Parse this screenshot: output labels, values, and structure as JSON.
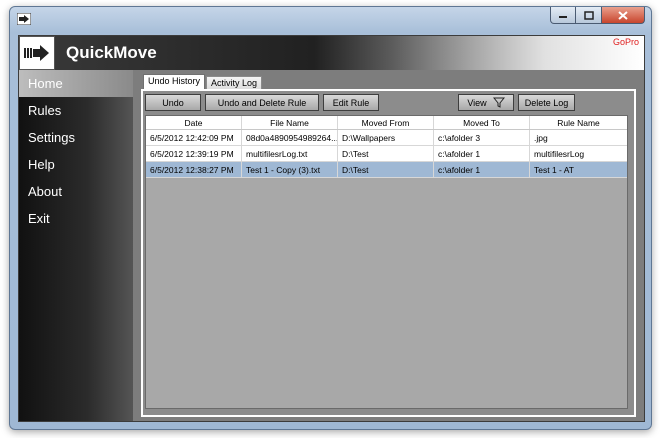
{
  "app": {
    "title": "QuickMove",
    "gopro_label": "GoPro"
  },
  "sidebar": {
    "items": [
      {
        "label": "Home",
        "active": true
      },
      {
        "label": "Rules"
      },
      {
        "label": "Settings"
      },
      {
        "label": "Help"
      },
      {
        "label": "About"
      },
      {
        "label": "Exit"
      }
    ]
  },
  "tabs": [
    {
      "label": "Undo History",
      "active": true
    },
    {
      "label": "Activity Log"
    }
  ],
  "toolbar": {
    "undo": "Undo",
    "undo_delete": "Undo and Delete Rule",
    "edit_rule": "Edit Rule",
    "view": "View",
    "delete_log": "Delete Log"
  },
  "table": {
    "headers": [
      "Date",
      "File Name",
      "Moved From",
      "Moved To",
      "Rule Name"
    ],
    "rows": [
      [
        "6/5/2012 12:42:09 PM",
        "08d0a4890954989264...",
        "D:\\Wallpapers",
        "c:\\afolder 3",
        ".jpg"
      ],
      [
        "6/5/2012 12:39:19 PM",
        "multifilesrLog.txt",
        "D:\\Test",
        "c:\\afolder 1",
        "multifilesrLog"
      ],
      [
        "6/5/2012 12:38:27 PM",
        "Test 1 - Copy (3).txt",
        "D:\\Test",
        "c:\\afolder 1",
        "Test 1 - AT"
      ]
    ],
    "selected_row": 2
  },
  "colors": {
    "selection": "#9fb8d4",
    "gopro": "#e02020"
  }
}
